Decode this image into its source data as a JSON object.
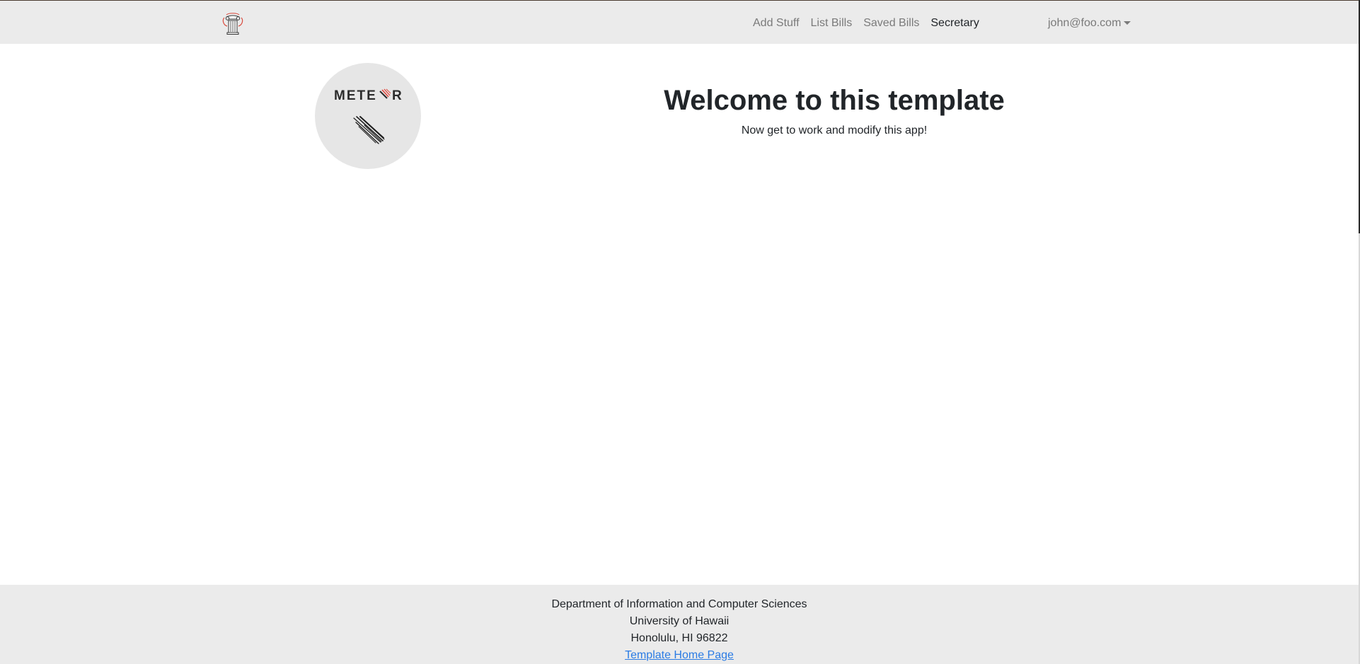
{
  "nav": {
    "links": [
      {
        "label": "Add Stuff"
      },
      {
        "label": "List Bills"
      },
      {
        "label": "Saved Bills"
      },
      {
        "label": "Secretary"
      }
    ],
    "user": "john@foo.com"
  },
  "hero": {
    "logo_text": "METEOR",
    "title": "Welcome to this template",
    "subtitle": "Now get to work and modify this app!"
  },
  "footer": {
    "line1": "Department of Information and Computer Sciences",
    "line2": "University of Hawaii",
    "line3": "Honolulu, HI 96822",
    "link": "Template Home Page"
  },
  "colors": {
    "nav_bg": "#ebebeb",
    "footer_bg": "#ebebeb",
    "link": "#2a7be4",
    "logo_circle": "#e6e6e6"
  }
}
